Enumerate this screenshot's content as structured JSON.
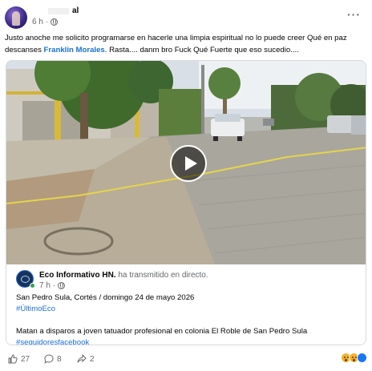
{
  "post": {
    "author_suffix": "al",
    "time": "6 h",
    "text": {
      "part1": "Justo anoche me solicito programarse en  hacerle una limpia espiritual no lo puede creer Qué en paz descanses ",
      "mention": "Franklin Morales",
      "part2": ". Rasta.... danm bro Fuck Qué Fuerte que eso sucedio...."
    }
  },
  "video": {
    "play_icon": "play-icon"
  },
  "shared": {
    "page_name": "Eco Informativo HN.",
    "action": "ha transmitido en directo.",
    "time": "7 h",
    "location_date": "San Pedro Sula, Cortés  / domingo 24 de mayo 2026",
    "hashtag1": "#ÚltimoEco",
    "headline": "Matan a disparos a joven tatuador profesional en colonia El Roble de San Pedro Sula",
    "hashtag2": "#seguidoresfacebook"
  },
  "footer": {
    "likes": "27",
    "comments": "8",
    "shares": "2"
  },
  "colors": {
    "link_blue": "#1a6fd1",
    "secondary_text": "#65676b",
    "live_green": "#31a24c"
  }
}
